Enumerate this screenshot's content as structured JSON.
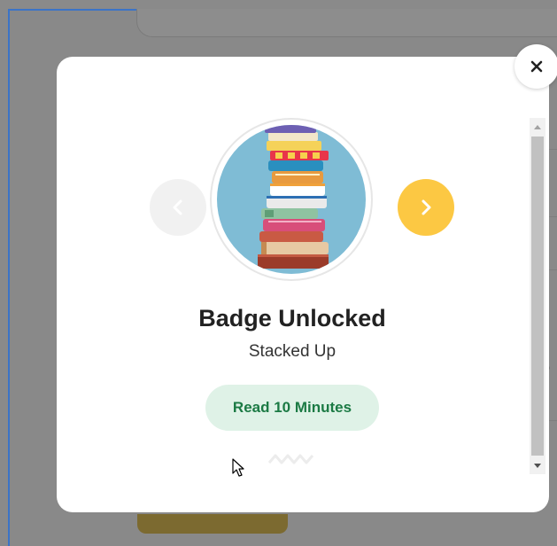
{
  "modal": {
    "badge_status": "Badge Unlocked",
    "badge_name": "Stacked Up",
    "requirement": "Read 10 Minutes"
  },
  "icons": {
    "close": "close-icon",
    "previous": "chevron-left-icon",
    "next": "chevron-right-icon",
    "badge": "stack-of-books-icon"
  },
  "colors": {
    "next_button": "#fcc843",
    "prev_button": "#f1f1f1",
    "requirement_bg": "#dff2e7",
    "requirement_text": "#1b7a44",
    "badge_bg": "#7fbcd5"
  }
}
